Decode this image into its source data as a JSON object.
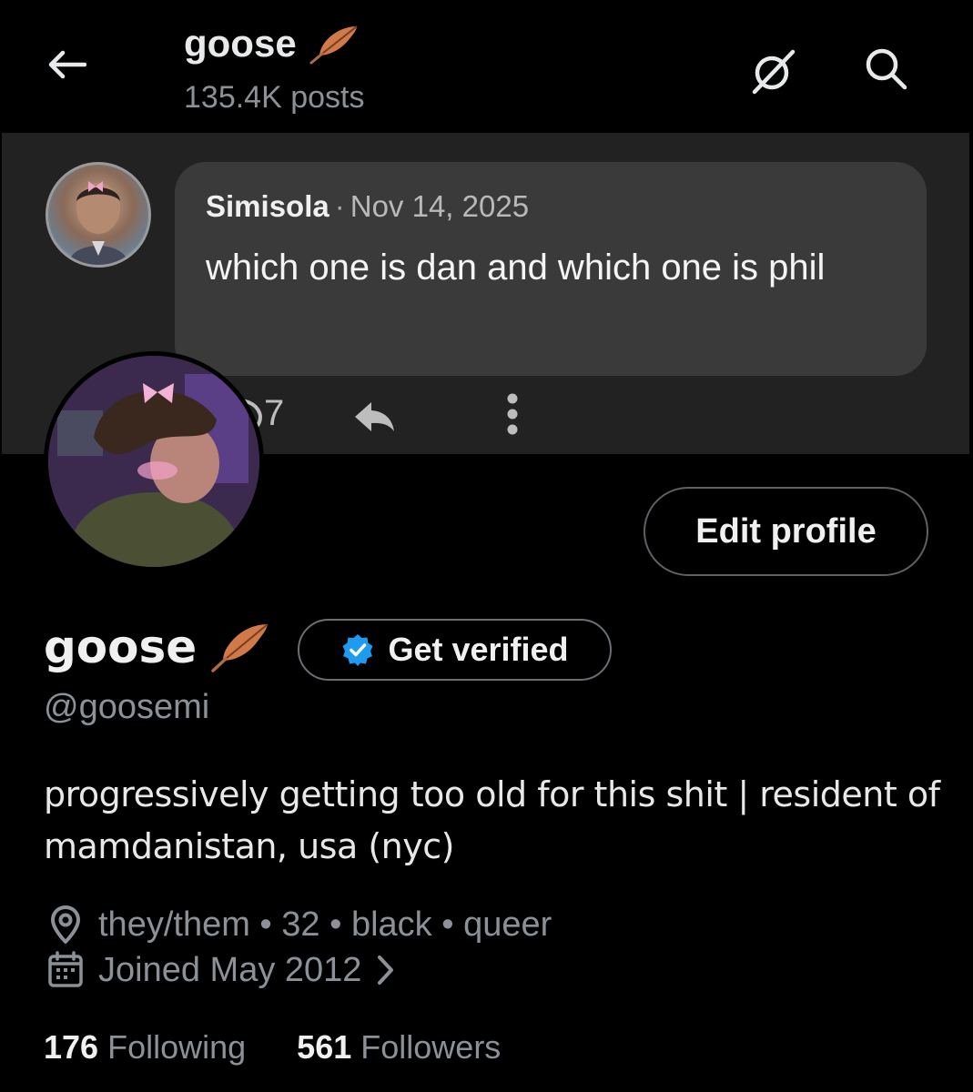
{
  "header": {
    "title": "goose",
    "post_count": "135.4K posts"
  },
  "pinned_reply": {
    "author": "Simisola",
    "separator": "·",
    "date": "Nov 14, 2025",
    "text": "which one is dan and which one is phil",
    "reply_count": "7"
  },
  "profile": {
    "edit_label": "Edit profile",
    "display_name": "goose",
    "verify_label": "Get verified",
    "handle": "@goosemi",
    "bio": "progressively getting too old for this shit | resident of mamdanistan, usa (nyc)",
    "location": "they/them • 32 • black • queer",
    "joined": "Joined May 2012",
    "following_count": "176",
    "following_label": "Following",
    "followers_count": "561",
    "followers_label": "Followers"
  },
  "icons": {
    "back": "back-arrow-icon",
    "grok": "grok-icon",
    "search": "search-icon",
    "feather": "feather-icon",
    "verified": "verified-badge-icon",
    "location": "location-pin-icon",
    "calendar": "calendar-icon",
    "chevron": "chevron-right-icon",
    "reply": "reply-icon",
    "share": "share-arrow-icon",
    "more": "more-vertical-icon"
  },
  "colors": {
    "background": "#000000",
    "banner": "#222222",
    "bubble": "#3a3a3a",
    "secondary_text": "#8b9196",
    "verified_blue": "#1d9bf0"
  }
}
